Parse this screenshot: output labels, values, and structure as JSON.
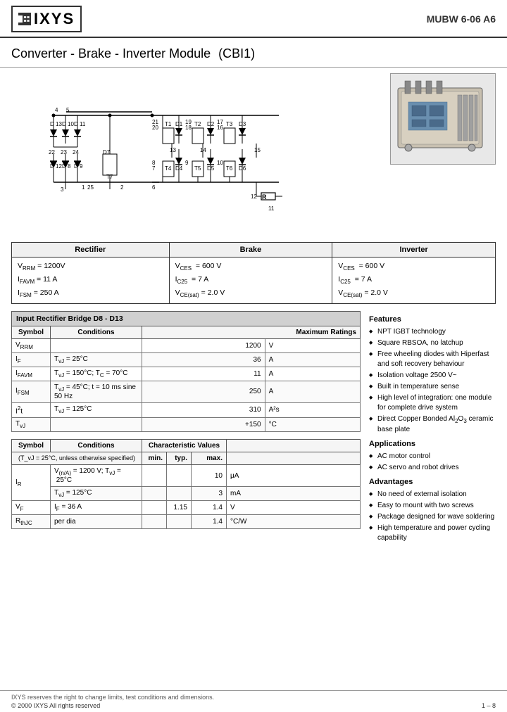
{
  "header": {
    "logo_text": "IXYS",
    "part_number": "MUBW 6-06 A6"
  },
  "title": {
    "main": "Converter - Brake - Inverter Module",
    "sub": "(CBI1)"
  },
  "specs": {
    "rectifier_label": "Rectifier",
    "brake_label": "Brake",
    "inverter_label": "Inverter",
    "rectifier_lines": [
      "V_RRM = 1200V",
      "I_FAVM = 11 A",
      "I_FSM = 250 A"
    ],
    "brake_lines": [
      "V_CES = 600 V",
      "I_C25 = 7 A",
      "V_CE(sat) = 2.0 V"
    ],
    "inverter_lines": [
      "V_CES = 600 V",
      "I_C25 = 7 A",
      "V_CE(sat) = 2.0 V"
    ]
  },
  "rectifier_table": {
    "title": "Input Rectifier Bridge D8 - D13",
    "columns": [
      "Symbol",
      "Conditions",
      "Maximum Ratings",
      ""
    ],
    "rows": [
      {
        "symbol": "V_RRM",
        "conditions": "",
        "value": "1200",
        "unit": "V"
      },
      {
        "symbol": "I_F",
        "conditions": "T_vJ = 25°C",
        "value": "36",
        "unit": "A"
      },
      {
        "symbol": "I_FAVM",
        "conditions": "T_vJ = 150°C; T_C = 70°C",
        "value": "11",
        "unit": "A"
      },
      {
        "symbol": "I_FSM",
        "conditions": "T_vJ = 45°C; t = 10 ms sine 50 Hz",
        "value": "250",
        "unit": "A"
      },
      {
        "symbol": "I²t",
        "conditions": "T_vJ = 125°C",
        "value": "310",
        "unit": "A²s"
      },
      {
        "symbol": "T_vJ",
        "conditions": "",
        "value": "+150",
        "unit": "°C"
      }
    ]
  },
  "char_table": {
    "columns": [
      "Symbol",
      "Conditions",
      "min.",
      "typ.",
      "max.",
      ""
    ],
    "note": "(T_vJ = 25°C, unless otherwise specified)",
    "rows": [
      {
        "symbol": "I_R",
        "conditions_line1": "V_(n/A) = 1200 V; T_vJ = 25°C",
        "conditions_line2": "T_vJ = 125°C",
        "min": "",
        "typ": "",
        "max_line1": "10",
        "max_line2": "3",
        "unit_line1": "μA",
        "unit_line2": "mA"
      },
      {
        "symbol": "V_F",
        "conditions": "I_F = 36 A",
        "min": "",
        "typ": "1.15",
        "max": "1.4",
        "unit": "V"
      },
      {
        "symbol": "R_thJC",
        "conditions": "per dia",
        "min": "",
        "typ": "",
        "max": "1.4",
        "unit": "°C/W"
      }
    ]
  },
  "features": {
    "title": "Features",
    "items": [
      "NPT IGBT technology",
      "Square RBSOA, no latchup",
      "Free wheeling diodes with Hiperfast and soft recovery behaviour",
      "Isolation voltage 2500 V~",
      "Built in temperature sense",
      "High level of integration: one module for complete drive system",
      "Direct Copper Bonded Al₂O₃ ceramic base plate"
    ]
  },
  "applications": {
    "title": "Applications",
    "items": [
      "AC motor control",
      "AC servo and robot drives"
    ]
  },
  "advantages": {
    "title": "Advantages",
    "items": [
      "No need of external isolation",
      "Easy to mount with two screws",
      "Package designed for wave soldering",
      "High temperature and power cycling capability"
    ]
  },
  "footer": {
    "legal": "IXYS reserves the right to change limits, test conditions and dimensions.",
    "copyright": "© 2000 IXYS All rights reserved",
    "page": "1 – 8"
  }
}
